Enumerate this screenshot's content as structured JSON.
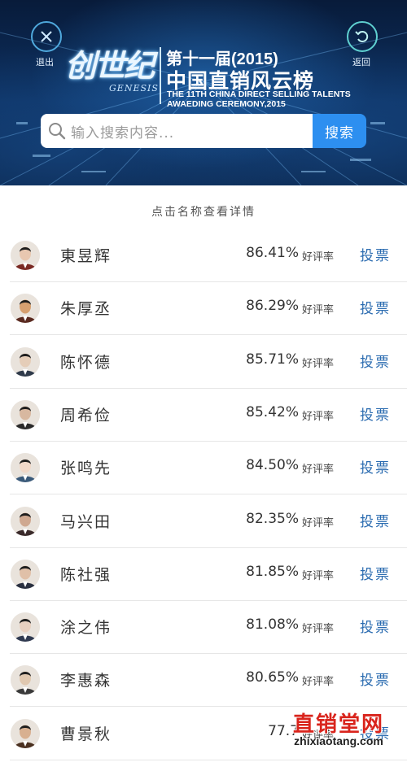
{
  "header": {
    "exit_label": "退出",
    "back_label": "返回",
    "logo_text": "创世纪",
    "logo_sub": "GENESIS",
    "title_line1": "第十一届(2015)",
    "title_line2": "中国直销风云榜",
    "title_en_line1": "THE 11TH CHINA DIRECT SELLING TALENTS",
    "title_en_line2": "AWAEDING CEREMONY,2015"
  },
  "search": {
    "placeholder": "输入搜索内容...",
    "button_label": "搜索"
  },
  "hint": "点击名称查看详情",
  "rate_label": "好评率",
  "vote_label": "投票",
  "rows": [
    {
      "name": "東昱辉",
      "rate": "86.41%"
    },
    {
      "name": "朱厚丞",
      "rate": "86.29%"
    },
    {
      "name": "陈怀德",
      "rate": "85.71%"
    },
    {
      "name": "周希俭",
      "rate": "85.42%"
    },
    {
      "name": "张鸣先",
      "rate": "84.50%"
    },
    {
      "name": "马兴田",
      "rate": "82.35%"
    },
    {
      "name": "陈社强",
      "rate": "81.85%"
    },
    {
      "name": "涂之伟",
      "rate": "81.08%"
    },
    {
      "name": "李惠森",
      "rate": "80.65%"
    },
    {
      "name": "曹景秋",
      "rate": "77.7"
    }
  ],
  "watermark": {
    "cn": "直销堂网",
    "en": "zhixiaotang.com"
  },
  "colors": {
    "accent_blue": "#2d8ff0",
    "vote_blue": "#2a6bb0",
    "watermark_red": "#d9241c"
  }
}
